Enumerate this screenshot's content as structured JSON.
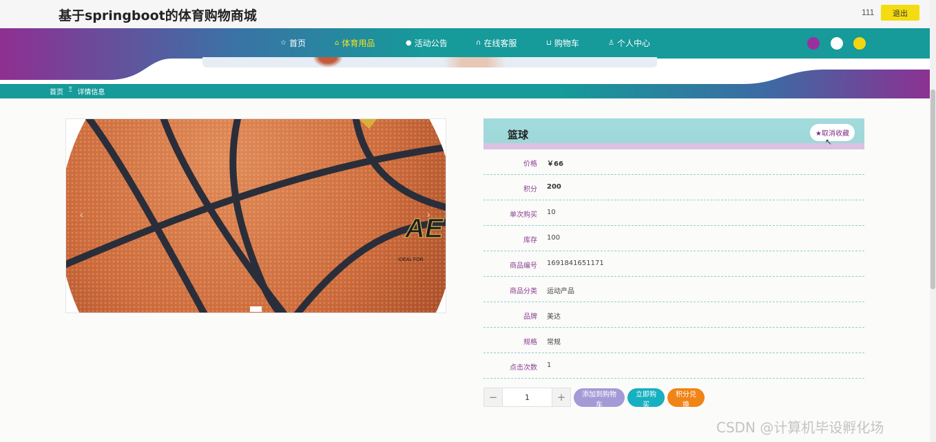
{
  "header": {
    "site_title": "基于springboot的体育购物商城",
    "username": "111",
    "logout_label": "退出"
  },
  "nav": {
    "items": [
      {
        "label": "首页",
        "icon": "star-outline-icon"
      },
      {
        "label": "体育用品",
        "icon": "bag-icon",
        "active": true
      },
      {
        "label": "活动公告",
        "icon": "info-icon"
      },
      {
        "label": "在线客服",
        "icon": "headset-icon"
      },
      {
        "label": "购物车",
        "icon": "cart-icon"
      },
      {
        "label": "个人中心",
        "icon": "user-icon"
      }
    ],
    "theme_dots": [
      "#9b2fa0",
      "#ffffff",
      "#f3d60f"
    ]
  },
  "breadcrumb": {
    "home": "首页",
    "separator": "Ξ",
    "current": "详情信息"
  },
  "gallery": {
    "brand_text": "AE",
    "tagline": "IDEAL FOR",
    "prev_glyph": "‹",
    "next_glyph": "›"
  },
  "product": {
    "name": "篮球",
    "favorite_label": "★取消收藏",
    "fields": [
      {
        "label": "价格",
        "value": "￥66",
        "bold": true
      },
      {
        "label": "积分",
        "value": "200",
        "bold": true
      },
      {
        "label": "单次购买",
        "value": "10"
      },
      {
        "label": "库存",
        "value": "100"
      },
      {
        "label": "商品编号",
        "value": "1691841651171"
      },
      {
        "label": "商品分类",
        "value": "运动产品"
      },
      {
        "label": "品牌",
        "value": "美达"
      },
      {
        "label": "规格",
        "value": "常规"
      },
      {
        "label": "点击次数",
        "value": "1"
      }
    ]
  },
  "actions": {
    "minus": "−",
    "quantity": "1",
    "plus": "+",
    "add_to_cart": "添加到购物车",
    "buy_now": "立即购买",
    "redeem_points": "积分兑换"
  },
  "watermark": "CSDN @计算机毕设孵化场",
  "colors": {
    "nav_teal": "#169a9a",
    "nav_purple": "#8f2f92",
    "accent_yellow": "#f5dc10",
    "label_purple": "#8a3f8e"
  }
}
